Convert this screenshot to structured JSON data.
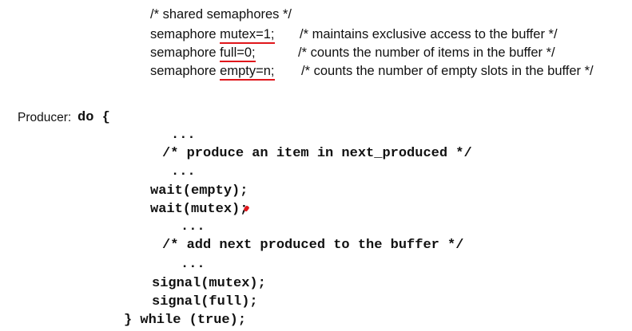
{
  "declarations": {
    "comment": "/* shared semaphores */",
    "keyword": "semaphore",
    "lines": [
      {
        "decl": "mutex=1;",
        "comment": "/* maintains exclusive access to the buffer */"
      },
      {
        "decl": "full=0;",
        "comment": "/* counts the number of items in the buffer */"
      },
      {
        "decl": "empty=n;",
        "comment": "/* counts the number of empty slots in the buffer */"
      }
    ]
  },
  "producer": {
    "label": "Producer:",
    "do_open": "do {",
    "ellipsis": "...",
    "produce_comment": "/* produce an item in next_produced */",
    "wait_empty": "wait(empty);",
    "wait_mutex": "wait(mutex);",
    "add_comment": "/* add next produced to the buffer */",
    "signal_mutex": "signal(mutex);",
    "signal_full": "signal(full);",
    "loop_close": "} while (true);"
  },
  "colors": {
    "text": "#111111",
    "annotation": "#e0161b"
  }
}
